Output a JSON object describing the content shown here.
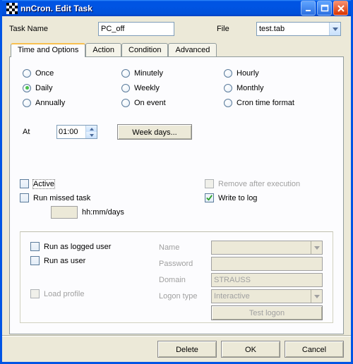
{
  "window": {
    "title": "nnCron. Edit Task"
  },
  "fields": {
    "task_name_label": "Task Name",
    "task_name_value": "PC_off",
    "file_label": "File",
    "file_value": "test.tab"
  },
  "tabs": {
    "time_and_options": "Time and Options",
    "action": "Action",
    "condition": "Condition",
    "advanced": "Advanced"
  },
  "schedule": {
    "once": "Once",
    "daily": "Daily",
    "annually": "Annually",
    "minutely": "Minutely",
    "weekly": "Weekly",
    "on_event": "On event",
    "hourly": "Hourly",
    "monthly": "Monthly",
    "cron_time_format": "Cron time format",
    "selected": "daily",
    "at_label": "At",
    "at_value": "01:00",
    "weekdays_btn": "Week days..."
  },
  "options": {
    "active": "Active",
    "run_missed": "Run missed task",
    "hhmmdays": "hh:mm/days",
    "remove_after": "Remove after execution",
    "write_to_log": "Write to log"
  },
  "runbox": {
    "run_logged": "Run as logged user",
    "run_as_user": "Run as user",
    "load_profile": "Load profile",
    "name": "Name",
    "password": "Password",
    "domain": "Domain",
    "domain_value": "STRAUSS",
    "logon_type": "Logon type",
    "logon_type_value": "Interactive",
    "test_logon": "Test logon"
  },
  "buttons": {
    "delete": "Delete",
    "ok": "OK",
    "cancel": "Cancel"
  }
}
